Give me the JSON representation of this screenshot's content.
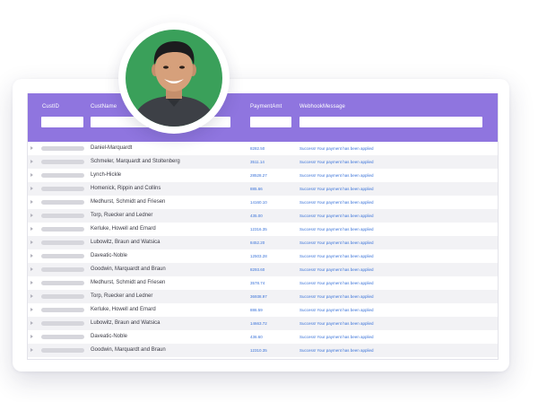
{
  "colors": {
    "header_bg": "#8f75df",
    "link_blue": "#3a73d9",
    "avatar_bg": "#3aa05a"
  },
  "grid": {
    "columns": [
      {
        "key": "custid",
        "label": "CustID"
      },
      {
        "key": "custname",
        "label": "CustName"
      },
      {
        "key": "amount",
        "label": "PaymentAmt"
      },
      {
        "key": "message",
        "label": "WebhookMessage"
      }
    ],
    "rows": [
      {
        "custname": "Daniel-Marquardt",
        "amount": "8282.50",
        "message": "Success! Your payment has been applied"
      },
      {
        "custname": "Schmeler, Marquardt and Stoltenberg",
        "amount": "3511.14",
        "message": "Success! Your payment has been applied"
      },
      {
        "custname": "Lynch-Hickle",
        "amount": "28528.27",
        "message": "Success! Your payment has been applied"
      },
      {
        "custname": "Homenick, Rippin and Collins",
        "amount": "885.66",
        "message": "Success! Your payment has been applied"
      },
      {
        "custname": "Medhurst, Schmidt and Friesen",
        "amount": "14160.10",
        "message": "Success! Your payment has been applied"
      },
      {
        "custname": "Torp, Ruecker and Ledner",
        "amount": "435.00",
        "message": "Success! Your payment has been applied"
      },
      {
        "custname": "Kerluke, Howell and Emard",
        "amount": "12316.35",
        "message": "Success! Your payment has been applied"
      },
      {
        "custname": "Lubowitz, Braun and Watsica",
        "amount": "8452.20",
        "message": "Success! Your payment has been applied"
      },
      {
        "custname": "Daveatic-Noble",
        "amount": "12503.28",
        "message": "Success! Your payment has been applied"
      },
      {
        "custname": "Goodwin, Marquardt and Braun",
        "amount": "8293.60",
        "message": "Success! Your payment has been applied"
      },
      {
        "custname": "Medhurst, Schmidt and Friesen",
        "amount": "3578.74",
        "message": "Success! Your payment has been applied"
      },
      {
        "custname": "Torp, Ruecker and Ledner",
        "amount": "36938.97",
        "message": "Success! Your payment has been applied"
      },
      {
        "custname": "Kerluke, Howell and Emard",
        "amount": "886.59",
        "message": "Success! Your payment has been applied"
      },
      {
        "custname": "Lubowitz, Braun and Watsica",
        "amount": "14663.72",
        "message": "Success! Your payment has been applied"
      },
      {
        "custname": "Daveatic-Noble",
        "amount": "436.60",
        "message": "Success! Your payment has been applied"
      },
      {
        "custname": "Goodwin, Marquardt and Braun",
        "amount": "12310.35",
        "message": "Success! Your payment has been applied"
      }
    ]
  }
}
